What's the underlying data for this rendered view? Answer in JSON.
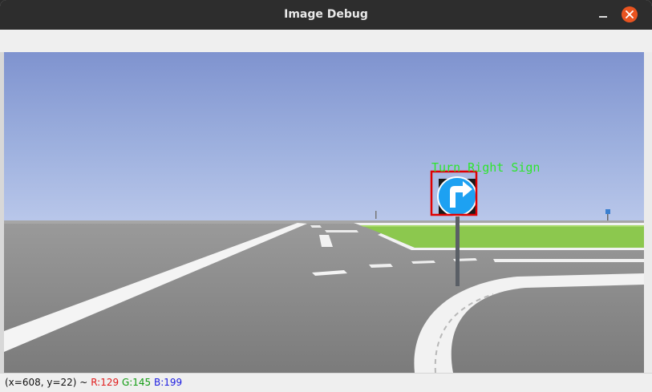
{
  "window": {
    "title": "Image Debug",
    "close_color": "#e95420"
  },
  "viewer": {
    "detection": {
      "label": "Turn Right Sign",
      "label_color": "#2ee52e",
      "box_color": "#e00000"
    },
    "sky_color": "#8fa2d8",
    "grass_color": "#8cc84e",
    "road_color": "#8a8a8a"
  },
  "status": {
    "coords": "(x=608, y=22) ~",
    "r": "R:129",
    "g": "G:145",
    "b": "B:199"
  }
}
